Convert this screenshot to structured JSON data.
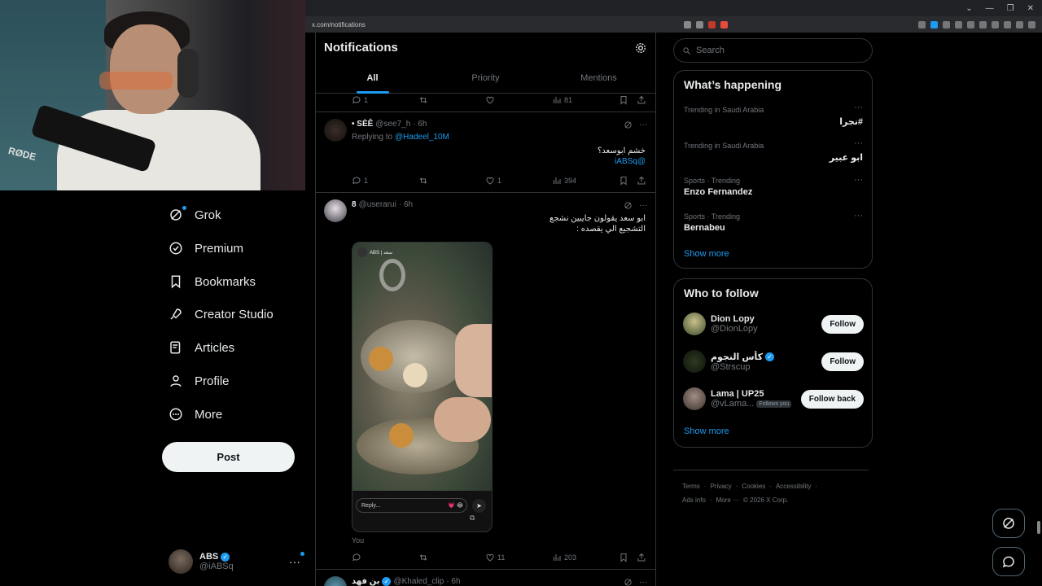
{
  "browser": {
    "url": "x.com/notifications"
  },
  "nav": {
    "items": [
      {
        "label": "Grok",
        "icon": "grok-icon"
      },
      {
        "label": "Premium",
        "icon": "premium-icon"
      },
      {
        "label": "Bookmarks",
        "icon": "bookmark-icon"
      },
      {
        "label": "Creator Studio",
        "icon": "rocket-icon"
      },
      {
        "label": "Articles",
        "icon": "article-icon"
      },
      {
        "label": "Profile",
        "icon": "person-icon"
      },
      {
        "label": "More",
        "icon": "more-circle-icon"
      }
    ],
    "post_label": "Post",
    "account": {
      "name": "ABS",
      "handle": "@iABSq"
    }
  },
  "webcam": {
    "brand_text": "RØDE"
  },
  "main": {
    "title": "Notifications",
    "tabs": [
      {
        "label": "All",
        "active": true
      },
      {
        "label": "Priority",
        "active": false
      },
      {
        "label": "Mentions",
        "active": false
      }
    ],
    "top_actions": {
      "replies": "1",
      "views": "81"
    },
    "tweets": [
      {
        "name": "• SÈÊ",
        "handle": "@see7_h",
        "time": "· 6h",
        "replying_prefix": "Replying to",
        "replying_to": "@Hadeel_10M",
        "text": "خشم ابوسعد؟",
        "mention": "@iABSq",
        "replies": "1",
        "retweets": "",
        "likes": "1",
        "views": "394"
      },
      {
        "name": "8",
        "handle": "@userarui",
        "time": "· 6h",
        "text_line1": "ابو سعد يقولون جايبين نشجع",
        "text_line2": "التشجيع الي يقصده :",
        "media_reply_placeholder": "Reply...",
        "media_reply_emojis": "💗 😂",
        "media_story_name": "ABS | سعد",
        "you_label": "You",
        "replies": "",
        "retweets": "",
        "likes": "11",
        "views": "203"
      },
      {
        "name": "بن فهد",
        "handle": "@Khaled_clip",
        "time": "· 6h"
      }
    ]
  },
  "sidebar": {
    "search_placeholder": "Search",
    "happening_title": "What’s happening",
    "trends": [
      {
        "meta": "Trending in Saudi Arabia",
        "name": "#نجرا",
        "rtl": true
      },
      {
        "meta": "Trending in Saudi Arabia",
        "name": "ابو عبير",
        "rtl": true
      },
      {
        "meta": "Sports · Trending",
        "name": "Enzo Fernandez",
        "rtl": false
      },
      {
        "meta": "Sports · Trending",
        "name": "Bernabeu",
        "rtl": false
      }
    ],
    "show_more": "Show more",
    "who_to_follow_title": "Who to follow",
    "follow": [
      {
        "name": "Dion Lopy",
        "handle": "@DionLopy",
        "button": "Follow",
        "verified": false
      },
      {
        "name": "كأس النجوم",
        "handle": "@Strscup",
        "button": "Follow",
        "verified": true
      },
      {
        "name": "Lama | UP25",
        "handle": "@vLama...",
        "button": "Follow back",
        "follows_you": "Follows you"
      }
    ],
    "show_more_2": "Show more",
    "footer_row1": [
      "Terms",
      "·",
      "Privacy",
      "·",
      "Cookies",
      "·",
      "Accessibility",
      "·"
    ],
    "footer_row2": [
      "Ads info",
      "·",
      "More ···",
      "© 2026 X Corp."
    ]
  },
  "colors": {
    "accent": "#1d9bf0",
    "bg": "#000000",
    "border": "#2f3336",
    "muted": "#71767b"
  }
}
